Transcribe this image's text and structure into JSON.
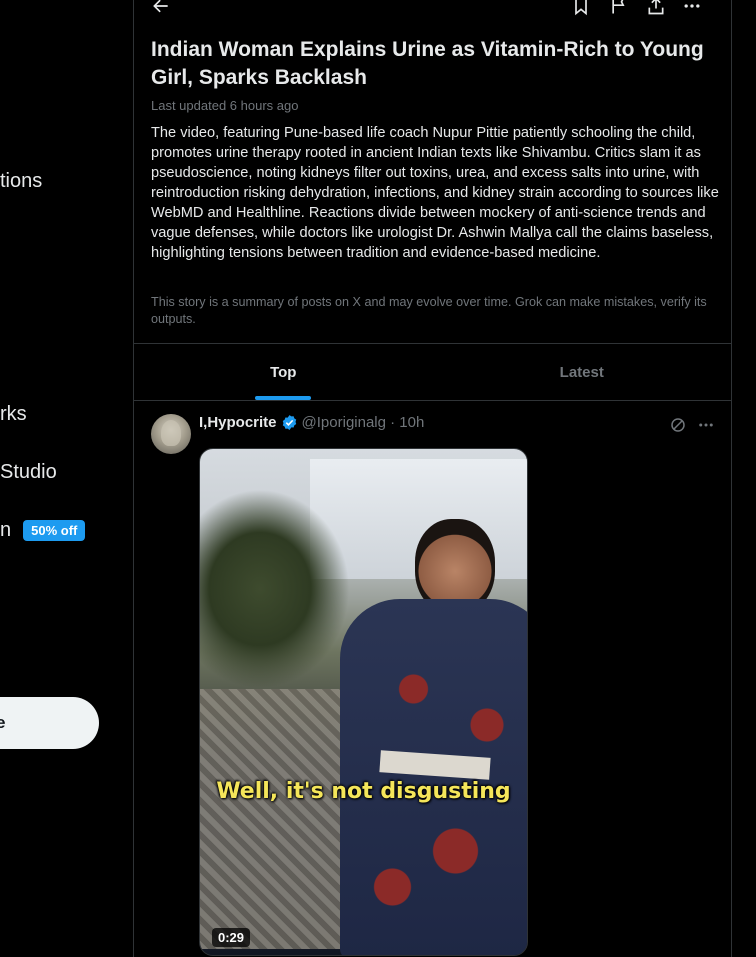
{
  "sidebar": {
    "items": [
      {
        "label": "tions"
      },
      {
        "label": "rks"
      },
      {
        "label": "Studio"
      },
      {
        "label": "n",
        "badge": "50% off"
      }
    ],
    "post_button": "e"
  },
  "topbar": {
    "icons": [
      "back-arrow-icon",
      "bookmark-icon",
      "flag-icon",
      "share-icon",
      "more-icon"
    ]
  },
  "story": {
    "headline": "Indian Woman Explains Urine as Vitamin-Rich to Young Girl, Sparks Backlash",
    "updated": "Last updated 6 hours ago",
    "summary": "The video, featuring Pune-based life coach Nupur Pittie patiently schooling the child, promotes urine therapy rooted in ancient Indian texts like Shivambu. Critics slam it as pseudoscience, noting kidneys filter out toxins, urea, and excess salts into urine, with reintroduction risking dehydration, infections, and kidney strain according to sources like WebMD and Healthline. Reactions divide between mockery of anti-science trends and vague defenses, while doctors like urologist Dr. Ashwin Mallya call the claims baseless, highlighting tensions between tradition and evidence-based medicine.",
    "disclaimer": "This story is a summary of posts on X and may evolve over time. Grok can make mistakes, verify its outputs."
  },
  "tabs": [
    {
      "label": "Top",
      "active": true
    },
    {
      "label": "Latest",
      "active": false
    }
  ],
  "post": {
    "author": "I,Hypocrite",
    "handle": "@Iporiginalg · 10h",
    "video_caption": "Well, it's not disgusting",
    "duration": "0:29"
  },
  "colors": {
    "accent": "#1d9bf0",
    "background": "#000000",
    "text": "#e7e9ea",
    "muted": "#71767b",
    "border": "#2f3336",
    "caption": "#f5e65a"
  }
}
